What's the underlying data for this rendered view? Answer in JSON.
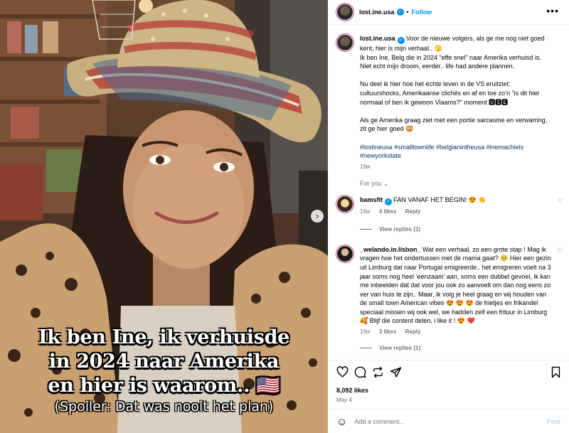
{
  "media": {
    "overlay_lines": [
      "Ik ben Ine, ik verhuisde",
      "in 2024 naar Amerika",
      "en hier is waarom.. 🇺🇸"
    ],
    "overlay_spoiler": "(Spoiler: Dat was nooit het plan)",
    "next_glyph": "›"
  },
  "header": {
    "username": "lost.ine.usa",
    "separator": "•",
    "follow_label": "Follow",
    "more_glyph": "•••"
  },
  "post": {
    "username": "lost.ine.usa",
    "caption_lines": [
      " Voor de nieuwe volgers, als ge me nog niet goed kent, hier is mijn verhaal.. 🫣",
      "Ik ben Ine, Belg die in 2024 “effe snel” naar Amerika verhuisd is. Niet echt mijn droom, eerder.. life had andere plannen.",
      "",
      "Nu deel ik hier hoe het echte leven in de VS eruitziet: cultuurshocks, Amerikaanse clichés en af en toe zo’n “is dit hier normaal of ben ik gewoon Vlaams?” moment 🆄🆂🅴",
      "",
      "Als ge Amerika graag ziet met een portie sarcasme en verwarring, zit ge hier goed 🥨"
    ],
    "hashtags": "#lostineusa #smalltownlife #belgianintheusa #inemachiels #newyorkstate",
    "age": "19w"
  },
  "for_you_label": "For you ⌄",
  "comments": [
    {
      "username": "bamsfit",
      "verified": true,
      "text": " FAN VANAF HET BEGIN! 😍 👏",
      "age": "19w",
      "likes": "4 likes",
      "reply_label": "Reply",
      "view_replies": "View replies (1)"
    },
    {
      "username": "_welando.in.lisbon_",
      "verified": false,
      "text": "  Wat een verhaal, zo een grote stap ! Mag ik vragen hoe het ondertussen met de mama gaat? 🥺  Hier een gezin uit Limburg dat naar Portugal emigreerde.. het emigreren voelt na 3 jaar soms nog heel ‘eenzaam’ aan, soms een dubbel gevoel, ik kan me inbeelden dat dat voor jou ook zo aanvoelt om dan nog eens zo ver van huis te zijn.. Maar, ik volg je heel graag en wij houden van de small town American vibes 😍 😍 😍  de frietjes en frikandel speciaal missen wij ook wel, we hadden zelf een frituur in Limburg 🥰  Blijf die content delen, i like it ! 😍 ❤️",
      "age": "19w",
      "likes": "3 likes",
      "reply_label": "Reply",
      "view_replies": "View replies (1)"
    }
  ],
  "stats": {
    "likes": "8,092 likes",
    "date": "May 4"
  },
  "add_comment": {
    "placeholder": "Add a comment...",
    "post_label": "Post",
    "emoji_icon": "☺"
  },
  "colors": {
    "accent": "#0095f6",
    "hashtag": "#00376b",
    "muted": "#737373",
    "post_disabled": "#b2dffc"
  }
}
